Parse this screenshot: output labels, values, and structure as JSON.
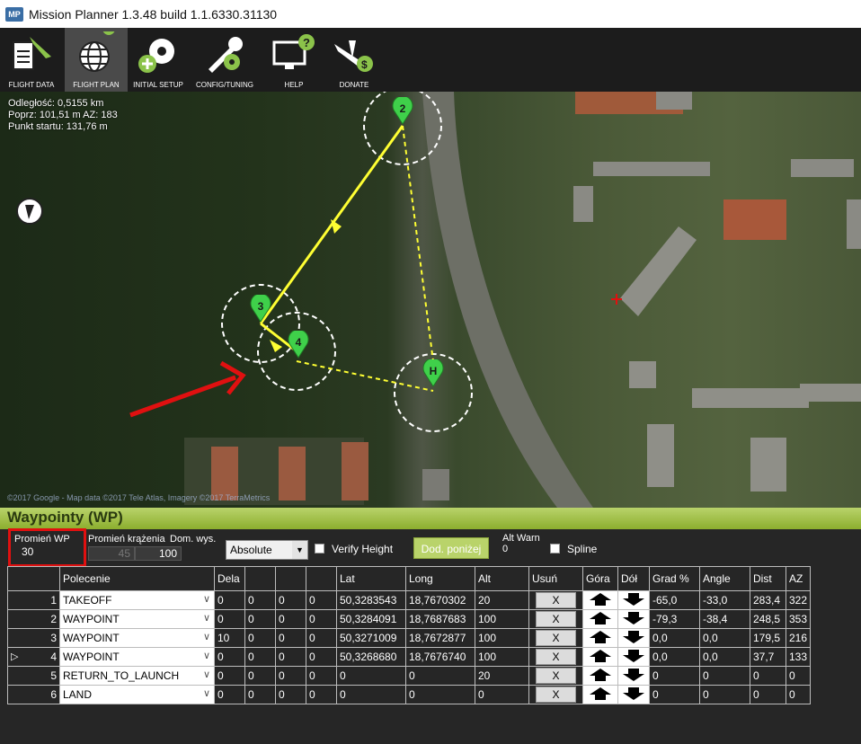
{
  "window": {
    "title": "Mission Planner 1.3.48 build 1.1.6330.31130",
    "app_icon_text": "MP"
  },
  "toolbar": [
    {
      "label": "FLIGHT DATA",
      "icon": "flight-data-icon",
      "active": false
    },
    {
      "label": "FLIGHT PLAN",
      "icon": "globe-icon",
      "active": true
    },
    {
      "label": "INITIAL SETUP",
      "icon": "gear-icon",
      "active": false
    },
    {
      "label": "CONFIG/TUNING",
      "icon": "wrench-icon",
      "active": false
    },
    {
      "label": "HELP",
      "icon": "monitor-help-icon",
      "active": false
    },
    {
      "label": "DONATE",
      "icon": "donate-plane-icon",
      "active": false
    }
  ],
  "map": {
    "info": [
      "Odległość: 0,5155 km",
      "Poprz: 101,51 m AZ: 183",
      "Punkt startu: 131,76 m"
    ],
    "copyright": "©2017 Google - Map data ©2017 Tele Atlas, Imagery ©2017 TerraMetrics",
    "markers": [
      "2",
      "3",
      "4",
      "H"
    ]
  },
  "panel": {
    "title": "Waypointy (WP)",
    "wp_radius_label": "Promień WP",
    "wp_radius_value": "30",
    "loiter_radius_label": "Promień krążenia",
    "loiter_radius_value": "45",
    "default_alt_label": "Dom. wys.",
    "default_alt_value": "100",
    "alt_mode": "Absolute",
    "verify_height_label": "Verify Height",
    "add_below_label": "Dod. poniżej",
    "alt_warn_label": "Alt Warn",
    "alt_warn_value": "0",
    "spline_label": "Spline"
  },
  "table": {
    "headers": [
      "",
      "Polecenie",
      "Dela",
      "",
      "",
      "",
      "Lat",
      "Long",
      "Alt",
      "Usuń",
      "Góra",
      "Dół",
      "Grad %",
      "Angle",
      "Dist",
      "AZ"
    ],
    "rows": [
      {
        "num": "1",
        "cmd": "TAKEOFF",
        "p1": "0",
        "p2": "0",
        "p3": "0",
        "p4": "0",
        "lat": "50,3283543",
        "lng": "18,7670302",
        "alt": "20",
        "del": "X",
        "grad": "-65,0",
        "angle": "-33,0",
        "dist": "283,4",
        "az": "322"
      },
      {
        "num": "2",
        "cmd": "WAYPOINT",
        "p1": "0",
        "p2": "0",
        "p3": "0",
        "p4": "0",
        "lat": "50,3284091",
        "lng": "18,7687683",
        "alt": "100",
        "del": "X",
        "grad": "-79,3",
        "angle": "-38,4",
        "dist": "248,5",
        "az": "353"
      },
      {
        "num": "3",
        "cmd": "WAYPOINT",
        "p1": "10",
        "p2": "0",
        "p3": "0",
        "p4": "0",
        "lat": "50,3271009",
        "lng": "18,7672877",
        "alt": "100",
        "del": "X",
        "grad": "0,0",
        "angle": "0,0",
        "dist": "179,5",
        "az": "216"
      },
      {
        "num": "4",
        "cmd": "WAYPOINT",
        "p1": "0",
        "p2": "0",
        "p3": "0",
        "p4": "0",
        "lat": "50,3268680",
        "lng": "18,7676740",
        "alt": "100",
        "del": "X",
        "grad": "0,0",
        "angle": "0,0",
        "dist": "37,7",
        "az": "133",
        "current": true
      },
      {
        "num": "5",
        "cmd": "RETURN_TO_LAUNCH",
        "p1": "0",
        "p2": "0",
        "p3": "0",
        "p4": "0",
        "lat": "0",
        "lng": "0",
        "alt": "20",
        "del": "X",
        "grad": "0",
        "angle": "0",
        "dist": "0",
        "az": "0"
      },
      {
        "num": "6",
        "cmd": "LAND",
        "p1": "0",
        "p2": "0",
        "p3": "0",
        "p4": "0",
        "lat": "0",
        "lng": "0",
        "alt": "0",
        "del": "X",
        "grad": "0",
        "angle": "0",
        "dist": "0",
        "az": "0"
      }
    ]
  },
  "colors": {
    "accent_green": "#b9d36a",
    "route_yellow": "#ffff33",
    "marker_green": "#3fd04a",
    "highlight_red": "#e01010"
  }
}
